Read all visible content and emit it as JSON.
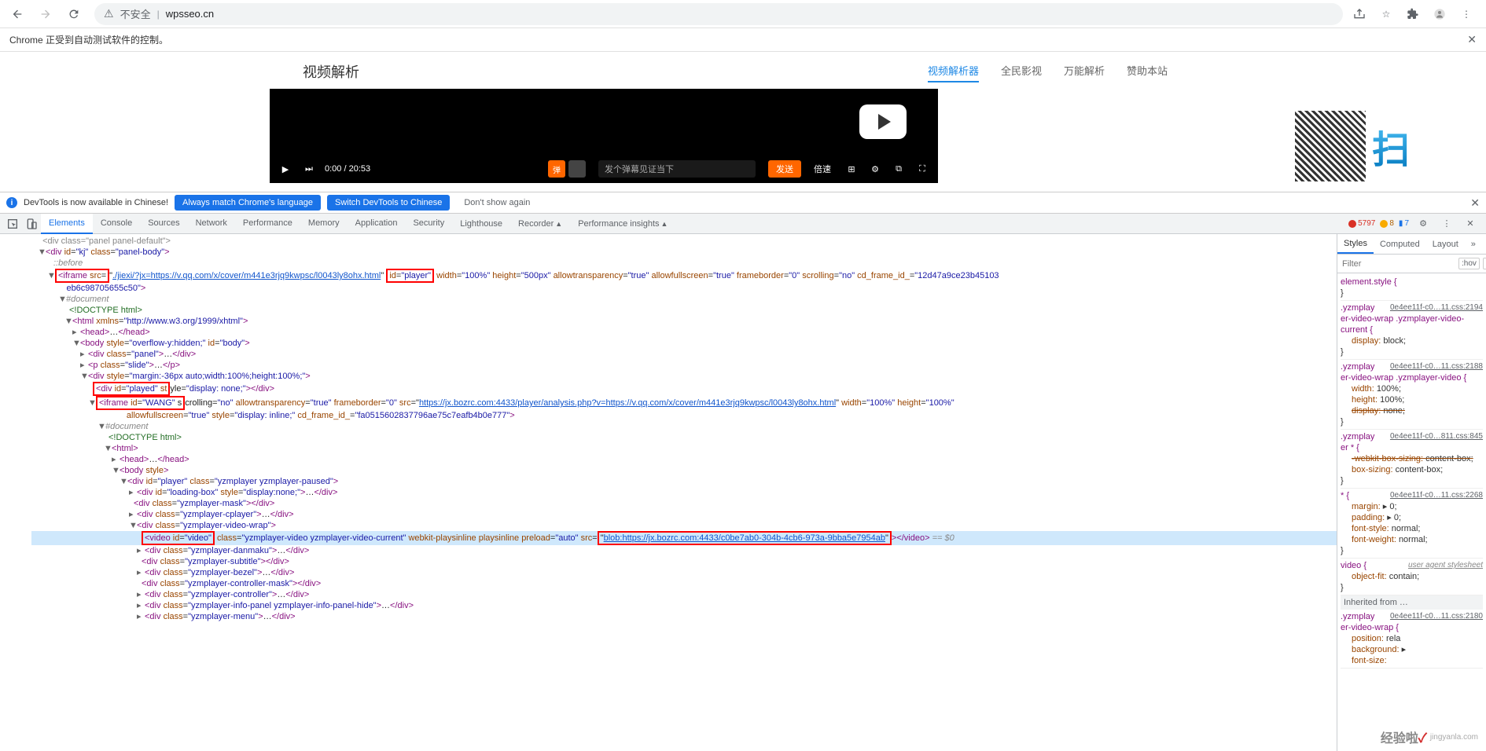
{
  "browser": {
    "insecure_label": "不安全",
    "url": "wpsseo.cn"
  },
  "auto_msg": "Chrome 正受到自动测试软件的控制。",
  "page": {
    "title": "视频解析",
    "nav": [
      "视频解析器",
      "全民影视",
      "万能解析",
      "赞助本站"
    ],
    "active_nav": 0
  },
  "video": {
    "time": "0:00 / 20:53",
    "danmaku_placeholder": "发个弹幕见证当下",
    "send": "发送",
    "speed": "倍速"
  },
  "devtools_notice": {
    "msg": "DevTools is now available in Chinese!",
    "btn1": "Always match Chrome's language",
    "btn2": "Switch DevTools to Chinese",
    "btn3": "Don't show again"
  },
  "dt_tabs": [
    "Elements",
    "Console",
    "Sources",
    "Network",
    "Performance",
    "Memory",
    "Application",
    "Security",
    "Lighthouse",
    "Recorder",
    "Performance insights"
  ],
  "dt_errors": {
    "err": "5797",
    "warn": "8",
    "info": "7"
  },
  "dom": {
    "l1": "<div class=\"panel panel-default\">",
    "l2_open": "<div id=\"kj\" class=\"panel-body\">",
    "l2_before": "::before",
    "iframe1_pre": "<iframe src=\"",
    "iframe1_href": "./jiexi/?jx=https://v.qq.com/x/cover/m441e3rjq9kwpsc/l0043ly8ohx.html",
    "iframe1_mid": "\" ",
    "iframe1_id": "id=\"player\"",
    "iframe1_rest": " width=\"100%\" height=\"500px\" allowtransparency=\"true\" allowfullscreen=\"true\" frameborder=\"0\" scrolling=\"no\" cd_frame_id_=\"12d47a9ce23b45103eb6c98705655c50\">",
    "doc1": "#document",
    "doctype": "<!DOCTYPE html>",
    "html1": "<html xmlns=\"http://www.w3.org/1999/xhtml\">",
    "head1": "<head>…</head>",
    "body1": "<body style=\"overflow-y:hidden;\" id=\"body\">",
    "div_panel": "<div class=\"panel\">…</div>",
    "p_slide": "<p class=\"slide\">…</p>",
    "div_margin": "<div style=\"margin:-36px auto;width:100%;height:100%;\">",
    "div_played": "<div id=\"played\" style=\"display: none;\"></div>",
    "iframe2_pre": "<iframe id=\"WANG\"",
    "iframe2_mid": " scrolling=\"no\" allowtransparency=\"true\" frameborder=\"0\" src=\"",
    "iframe2_href": "https://jx.bozrc.com:4433/player/analysis.php?v=https://v.qq.com/x/cover/m441e3rjq9kwpsc/l0043ly8ohx.html",
    "iframe2_rest": "\" width=\"100%\" height=\"100%\" allowfullscreen=\"true\" style=\"display: inline;\" cd_frame_id_=\"fa0515602837796ae75c7eafb4b0e777\">",
    "doc2": "#document",
    "doctype2": "<!DOCTYPE html>",
    "html2": "<html>",
    "head2": "<head>…</head>",
    "body2": "<body style>",
    "div_player": "<div id=\"player\" class=\"yzmplayer yzmplayer-paused\">",
    "div_loading": "<div id=\"loading-box\" style=\"display:none;\">…</div>",
    "div_mask": "<div class=\"yzmplayer-mask\"></div>",
    "div_cplayer": "<div class=\"yzmplayer-cplayer\">…</div>",
    "div_wrap": "<div class=\"yzmplayer-video-wrap\">",
    "video_pre": "<video id=\"video\"",
    "video_mid": " class=\"yzmplayer-video yzmplayer-video-current\" webkit-playsinline playsinline preload=\"auto\" src=\"",
    "video_href": "blob:https://jx.bozrc.com:4433/c0be7ab0-304b-4cb6-973a-9bba5e7954ab",
    "video_end": "\"></video>",
    "eq0": " == $0",
    "div_danmaku": "<div class=\"yzmplayer-danmaku\">…</div>",
    "div_subtitle": "<div class=\"yzmplayer-subtitle\"></div>",
    "div_bezel": "<div class=\"yzmplayer-bezel\">…</div>",
    "div_ctrlmask": "<div class=\"yzmplayer-controller-mask\"></div>",
    "div_ctrl": "<div class=\"yzmplayer-controller\">…</div>",
    "div_info": "<div class=\"yzmplayer-info-panel yzmplayer-info-panel-hide\">…</div>",
    "div_menu": "<div class=\"yzmplayer-menu\">…</div>"
  },
  "styles_tabs": [
    "Styles",
    "Computed",
    "Layout"
  ],
  "filter_placeholder": "Filter",
  "hov": ":hov",
  "cls": ".cls",
  "rules": [
    {
      "sel": "element.style {",
      "file": "",
      "props": [],
      "close": "}"
    },
    {
      "sel": ".yzmplay",
      "file": "0e4ee11f-c0…11.css:2194",
      "sel2": "er-video-wrap .yzmplayer-video-current {",
      "props": [
        {
          "n": "display",
          "v": "block;"
        }
      ],
      "close": "}"
    },
    {
      "sel": ".yzmplay",
      "file": "0e4ee11f-c0…11.css:2188",
      "sel2": "er-video-wrap .yzmplayer-video {",
      "props": [
        {
          "n": "width",
          "v": "100%;"
        },
        {
          "n": "height",
          "v": "100%;"
        },
        {
          "n": "display",
          "v": "none;",
          "struck": true
        }
      ],
      "close": "}"
    },
    {
      "sel": ".yzmplay",
      "file": "0e4ee11f-c0…811.css:845",
      "sel2": "er * {",
      "props": [
        {
          "n": "-webkit-box-sizing",
          "v": "content-box;",
          "struck": true
        },
        {
          "n": "box-sizing",
          "v": "content-box;"
        }
      ],
      "close": "}"
    },
    {
      "sel": "* {",
      "file": "0e4ee11f-c0…11.css:2268",
      "props": [
        {
          "n": "margin",
          "v": "▸ 0;"
        },
        {
          "n": "padding",
          "v": "▸ 0;"
        },
        {
          "n": "font-style",
          "v": "normal;"
        },
        {
          "n": "font-weight",
          "v": "normal;"
        }
      ],
      "close": "}"
    },
    {
      "sel": "video {",
      "file": "user agent stylesheet",
      "ua": true,
      "props": [
        {
          "n": "object-fit",
          "v": "contain;"
        }
      ],
      "close": "}"
    }
  ],
  "inherited": "Inherited from …",
  "rule_inh": {
    "sel": ".yzmplay",
    "file": "0e4ee11f-c0…11.css:2180",
    "sel2": "er-video-wrap {",
    "props": [
      {
        "n": "position",
        "v": "rela",
        "struck": false
      },
      {
        "n": "background",
        "v": "▸",
        "struck": false
      },
      {
        "n": "font-size",
        "v": "",
        "struck": false
      }
    ]
  },
  "watermark": {
    "text1": "经验啦",
    "text2": "jingyanla.com"
  }
}
